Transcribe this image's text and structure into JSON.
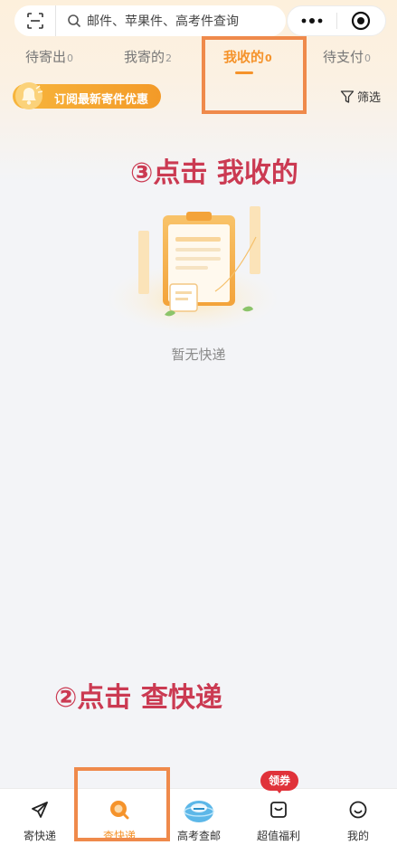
{
  "search": {
    "placeholder": "邮件、苹果件、高考件查询"
  },
  "tabs": [
    {
      "label": "待寄出",
      "count": "0"
    },
    {
      "label": "我寄的",
      "count": "2"
    },
    {
      "label": "我收的",
      "count": "0"
    },
    {
      "label": "待支付",
      "count": "0"
    }
  ],
  "active_tab": "我收的",
  "subscribe": {
    "label": "订阅最新寄件优惠"
  },
  "filter": {
    "label": "筛选"
  },
  "annotations": {
    "step3": "③点击 我收的",
    "step2": "②点击 查快递"
  },
  "empty": {
    "text": "暂无快递"
  },
  "bottom_nav": [
    {
      "label": "寄快递",
      "icon": "send-plane-icon"
    },
    {
      "label": "查快递",
      "icon": "search-orange-icon"
    },
    {
      "label": "高考查邮",
      "icon": "gaokao-globe-icon"
    },
    {
      "label": "超值福利",
      "icon": "gift-box-icon"
    },
    {
      "label": "我的",
      "icon": "smiley-icon"
    }
  ],
  "coupon_badge": "领券",
  "colors": {
    "accent": "#f5932b",
    "annotation": "#cb3a52",
    "highlight_box": "#ef8a4b",
    "badge": "#e0323a"
  }
}
